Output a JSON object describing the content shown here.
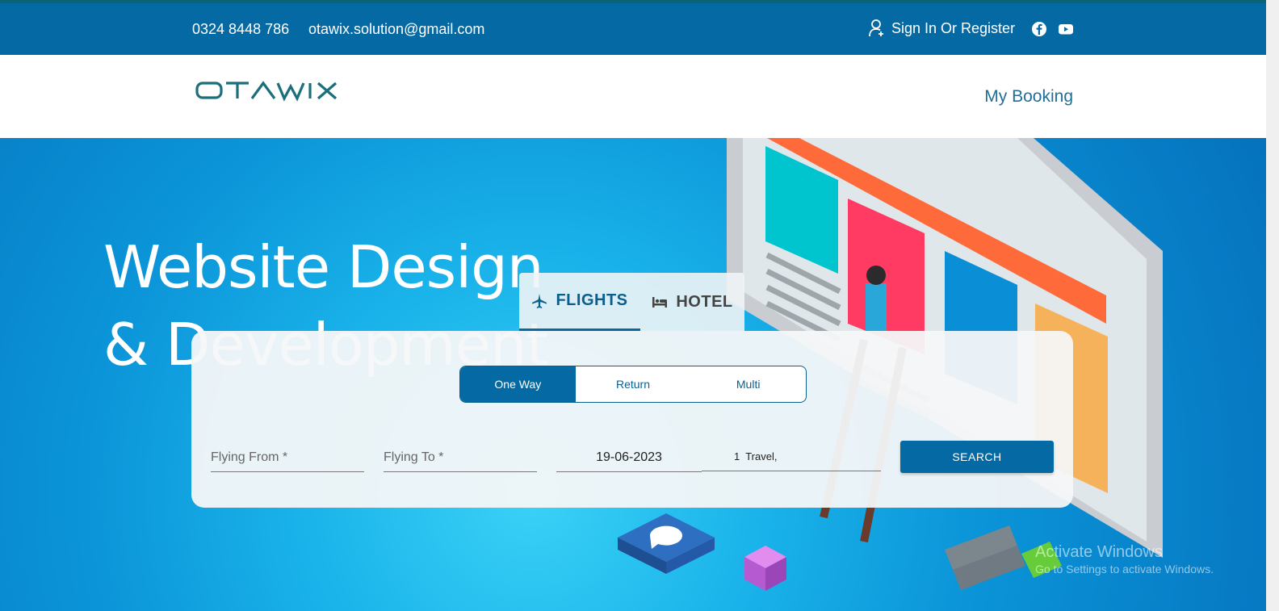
{
  "topbar": {
    "phone": "0324 8448 786",
    "email": "otawix.solution@gmail.com",
    "signin_label": "Sign In Or Register"
  },
  "header": {
    "logo_text": "OTAWIX",
    "my_booking_label": "My Booking"
  },
  "hero": {
    "title_line1": "Website Design",
    "title_line2": "& Development"
  },
  "search": {
    "tabs": [
      {
        "label": "FLIGHTS",
        "icon": "airplane-icon",
        "active": true
      },
      {
        "label": "HOTEL",
        "icon": "bed-icon",
        "active": false
      }
    ],
    "trip_types": [
      {
        "label": "One Way",
        "active": true
      },
      {
        "label": "Return",
        "active": false
      },
      {
        "label": "Multi",
        "active": false
      }
    ],
    "flying_from_placeholder": "Flying From *",
    "flying_to_placeholder": "Flying To *",
    "date_value": "19-06-2023",
    "travel_value": "1  Travel,",
    "search_label": "SEARCH"
  },
  "watermark": {
    "line1": "Activate Windows",
    "line2": "Go to Settings to activate Windows."
  },
  "colors": {
    "primary": "#0569a3",
    "logo": "#1b6f7a",
    "link": "#1f6e97"
  }
}
